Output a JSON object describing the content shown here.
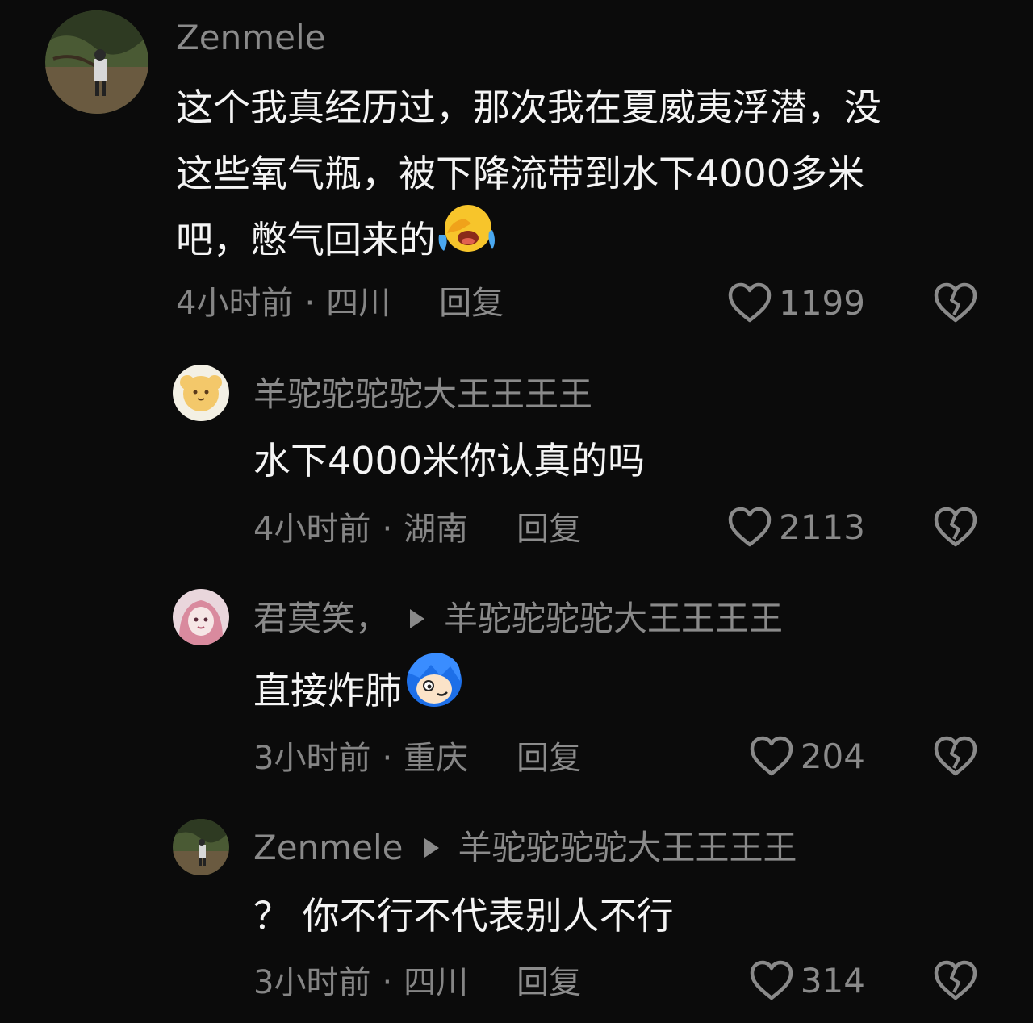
{
  "comments": [
    {
      "username": "Zenmele",
      "reply_to": "",
      "lines": [
        "这个我真经历过，那次我在夏威夷浮潜，没",
        "这些氧气瓶，被下降流带到水下4000多米",
        "吧，憋气回来的"
      ],
      "emoji": "facepalm-laughing-emoji",
      "time": "4小时前",
      "location": "四川",
      "reply_label": "回复",
      "likes": "1199"
    },
    {
      "username": "羊驼驼驼驼大王王王王",
      "reply_to": "",
      "lines": [
        "水下4000米你认真的吗"
      ],
      "emoji": "",
      "time": "4小时前",
      "location": "湖南",
      "reply_label": "回复",
      "likes": "2113"
    },
    {
      "username": "君莫笑，",
      "reply_to": "羊驼驼驼驼大王王王王",
      "lines": [
        "直接炸肺"
      ],
      "emoji": "blue-hair-emoji",
      "time": "3小时前",
      "location": "重庆",
      "reply_label": "回复",
      "likes": "204"
    },
    {
      "username": "Zenmele",
      "reply_to": "羊驼驼驼驼大王王王王",
      "lines": [
        "？ 你不行不代表别人不行"
      ],
      "emoji": "",
      "time": "3小时前",
      "location": "四川",
      "reply_label": "回复",
      "likes": "314"
    }
  ],
  "separator": "·",
  "icons": {
    "like": "heart-outline-icon",
    "dislike": "broken-heart-icon"
  },
  "colors": {
    "background": "#0b0b0b",
    "text": "#f4f4f4",
    "muted": "#8a8a8a"
  }
}
